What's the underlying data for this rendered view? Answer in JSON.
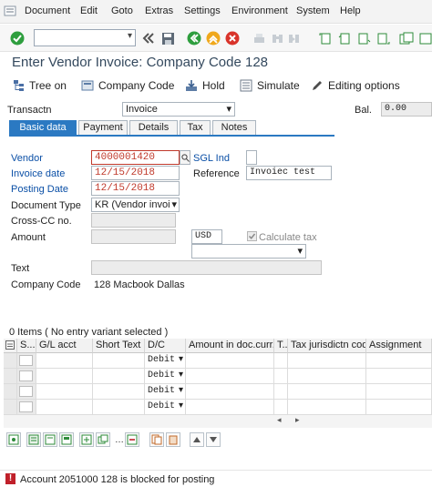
{
  "menu": {
    "items": [
      "Document",
      "Edit",
      "Goto",
      "Extras",
      "Settings",
      "Environment",
      "System",
      "Help"
    ]
  },
  "toolbar": {
    "command_value": ""
  },
  "page_title": "Enter Vendor Invoice: Company Code 128",
  "app_toolbar": {
    "tree_on": "Tree on",
    "company_code": "Company Code",
    "hold": "Hold",
    "simulate": "Simulate",
    "editing_options": "Editing options"
  },
  "transaction": {
    "label": "Transactn",
    "value": "Invoice"
  },
  "balance": {
    "label": "Bal.",
    "value": "0.00"
  },
  "tabs": [
    "Basic data",
    "Payment",
    "Details",
    "Tax",
    "Notes"
  ],
  "form": {
    "vendor_label": "Vendor",
    "vendor_value": "4000001420",
    "sgl_label": "SGL Ind",
    "invoice_date_label": "Invoice date",
    "invoice_date_value": "12/15/2018",
    "reference_label": "Reference",
    "reference_value": "Invoiec test",
    "posting_date_label": "Posting Date",
    "posting_date_value": "12/15/2018",
    "doc_type_label": "Document Type",
    "doc_type_value": "KR (Vendor invoic...",
    "cross_cc_label": "Cross-CC no.",
    "amount_label": "Amount",
    "currency_value": "USD",
    "calc_tax_label": "Calculate tax",
    "text_label": "Text",
    "company_code_label": "Company Code",
    "company_code_value": "128 Macbook Dallas"
  },
  "items_table": {
    "caption": "0 Items ( No entry variant selected )",
    "headers": [
      "S...",
      "G/L acct",
      "Short Text",
      "D/C",
      "Amount in doc.curr.",
      "T..",
      "Tax jurisdictn code",
      "Assignment"
    ],
    "rows": [
      {
        "dc": "Debit"
      },
      {
        "dc": "Debit"
      },
      {
        "dc": "Debit"
      },
      {
        "dc": "Debit"
      }
    ]
  },
  "status": {
    "message": "Account 2051000 128 is blocked for posting"
  },
  "colors": {
    "accent_blue": "#2b79c2",
    "error_red": "#c0202a",
    "label_blue": "#0a4fa6"
  }
}
